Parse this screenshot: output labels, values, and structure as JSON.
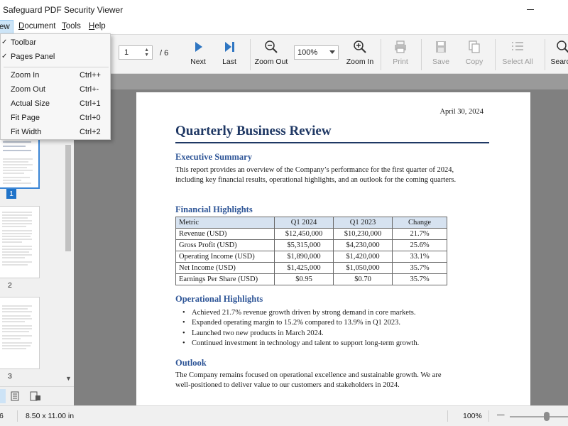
{
  "window": {
    "title": "d Safeguard PDF Security Viewer"
  },
  "menubar": {
    "items": [
      {
        "label": "ew"
      },
      {
        "label": "Document",
        "accel": "D",
        "rest": "ocument"
      },
      {
        "label": "Tools",
        "accel": "T",
        "rest": "ools"
      },
      {
        "label": "Help",
        "accel": "H",
        "rest": "elp"
      }
    ]
  },
  "toolbar": {
    "page_current": "1",
    "page_total": "/ 6",
    "next_label": "Next",
    "last_label": "Last",
    "zoom_out_label": "Zoom Out",
    "zoom_value": "100%",
    "zoom_in_label": "Zoom In",
    "print_label": "Print",
    "save_label": "Save",
    "copy_label": "Copy",
    "select_all_label": "Select All",
    "search_label": "Search",
    "accent_color": "#1f73c9"
  },
  "view_menu": {
    "items": [
      {
        "label": "Toolbar",
        "checked": true,
        "shortcut": ""
      },
      {
        "label": "Pages Panel",
        "checked": true,
        "shortcut": ""
      },
      {
        "label": "Zoom In",
        "shortcut": "Ctrl++"
      },
      {
        "label": "Zoom Out",
        "shortcut": "Ctrl+-"
      },
      {
        "label": "Actual Size",
        "shortcut": "Ctrl+1"
      },
      {
        "label": "Fit Page",
        "shortcut": "Ctrl+0"
      },
      {
        "label": "Fit Width",
        "shortcut": "Ctrl+2"
      }
    ]
  },
  "thumbnails": {
    "selected_page": 1,
    "labels": [
      "1",
      "2",
      "3"
    ]
  },
  "document": {
    "date": "April 30, 2024",
    "title": "Quarterly Business Review",
    "exec_heading": "Executive Summary",
    "exec_text": "This report provides an overview of the Company’s performance for the first quarter of 2024, including key financial results, operational highlights, and an outlook for the coming quarters.",
    "fin_heading": "Financial Highlights",
    "table": {
      "headers": [
        "Metric",
        "Q1 2024",
        "Q1 2023",
        "Change"
      ],
      "rows": [
        [
          "Revenue (USD)",
          "$12,450,000",
          "$10,230,000",
          "21.7%"
        ],
        [
          "Gross Profit (USD)",
          "$5,315,000",
          "$4,230,000",
          "25.6%"
        ],
        [
          "Operating Income (USD)",
          "$1,890,000",
          "$1,420,000",
          "33.1%"
        ],
        [
          "Net Income (USD)",
          "$1,425,000",
          "$1,050,000",
          "35.7%"
        ],
        [
          "Earnings Per Share (USD)",
          "$0.95",
          "$0.70",
          "35.7%"
        ]
      ]
    },
    "ops_heading": "Operational Highlights",
    "ops_bullets": [
      "Achieved 21.7% revenue growth driven by strong demand in core markets.",
      "Expanded operating margin to 15.2% compared to 13.9% in Q1 2023.",
      "Launched two new products in March 2024.",
      "Continued investment in technology and talent to support long-term growth."
    ],
    "outlook_heading": "Outlook",
    "outlook_text": "The Company remains focused on operational excellence and sustainable growth. We are well-positioned to deliver value to our customers and stakeholders in 2024.",
    "heading_color": "#1f3864",
    "subheading_color": "#2e5597"
  },
  "statusbar": {
    "page_fragment": "6",
    "page_size": "8.50 x 11.00 in",
    "zoom": "100%",
    "zoom_minus": "—",
    "zoom_level": 0.6
  }
}
